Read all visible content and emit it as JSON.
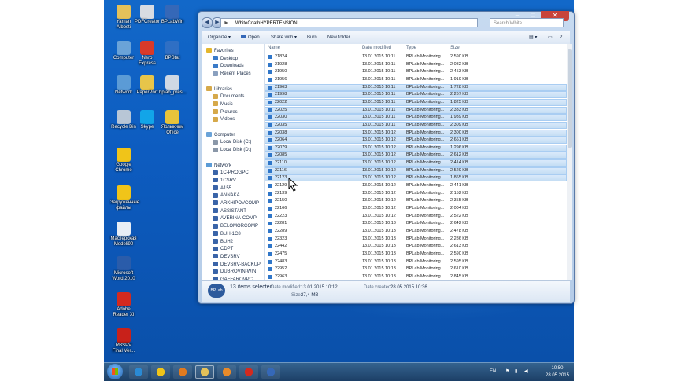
{
  "desktop_icons": [
    {
      "label": "Yaman Albosti",
      "icon": "folder-icon",
      "color": "#e4c15a"
    },
    {
      "label": "PDFCreator",
      "icon": "pdfcreator-icon",
      "color": "#d8dce2"
    },
    {
      "label": "BPLabWin",
      "icon": "bplab-icon",
      "color": "#3568b8"
    },
    {
      "label": "Computer",
      "icon": "computer-icon",
      "color": "#6aa3d8"
    },
    {
      "label": "Nero Express",
      "icon": "nero-icon",
      "color": "#d83a2a"
    },
    {
      "label": "BPStat",
      "icon": "bpstat-icon",
      "color": "#2f6fc4"
    },
    {
      "label": "Network",
      "icon": "network-icon",
      "color": "#5b9bd6"
    },
    {
      "label": "PaperPort",
      "icon": "paperport-icon",
      "color": "#e7c54a"
    },
    {
      "label": "bplab_pres...",
      "icon": "presentation-icon",
      "color": "#cfd8e4"
    },
    {
      "label": "Recycle Bin",
      "icon": "recycle-bin-icon",
      "color": "#b8c6d6"
    },
    {
      "label": "Skype",
      "icon": "skype-icon",
      "color": "#12a5e8"
    },
    {
      "label": "Ярлыкивм Office",
      "icon": "office-icon",
      "color": "#e7c33b"
    },
    {
      "label": "Google Chrome",
      "icon": "chrome-icon",
      "color": "#f0c419"
    },
    {
      "label": "Загруженные файлы",
      "icon": "chrome-icon",
      "color": "#f0c419"
    },
    {
      "label": "Мастерская Medeli90",
      "icon": "document-icon",
      "color": "#e8eef5"
    },
    {
      "label": "Microsoft Word 2010",
      "icon": "word-icon",
      "color": "#2a5caa"
    },
    {
      "label": "Adobe Reader XI",
      "icon": "adobe-reader-icon",
      "color": "#d32a1f"
    },
    {
      "label": "RBSPV Final Ver...",
      "icon": "app-icon",
      "color": "#c8211a"
    }
  ],
  "window": {
    "address": "WhiteCoathHYPERTENSION",
    "search_placeholder": "Search White...",
    "controls": {
      "minimize": "–",
      "maximize": "□",
      "close": "✕"
    },
    "nav_back": "◀",
    "nav_forward": "▶",
    "toolbar": {
      "organize": "Organize ▾",
      "open": "Open",
      "share": "Share with ▾",
      "burn": "Burn",
      "new_folder": "New folder"
    },
    "nav_items": [
      {
        "label": "Favorites",
        "icon": "star-icon",
        "color": "#e4b62c",
        "level": 0
      },
      {
        "label": "Desktop",
        "icon": "desktop-icon",
        "color": "#3a7bc8",
        "level": 1
      },
      {
        "label": "Downloads",
        "icon": "downloads-icon",
        "color": "#3a7bc8",
        "level": 1
      },
      {
        "label": "Recent Places",
        "icon": "recent-places-icon",
        "color": "#8aa0bf",
        "level": 1
      },
      {
        "label": "",
        "icon": "",
        "color": "",
        "level": -1
      },
      {
        "label": "Libraries",
        "icon": "libraries-icon",
        "color": "#d6a94a",
        "level": 0
      },
      {
        "label": "Documents",
        "icon": "documents-icon",
        "color": "#d6a94a",
        "level": 1
      },
      {
        "label": "Music",
        "icon": "music-icon",
        "color": "#d6a94a",
        "level": 1
      },
      {
        "label": "Pictures",
        "icon": "pictures-icon",
        "color": "#d6a94a",
        "level": 1
      },
      {
        "label": "Videos",
        "icon": "videos-icon",
        "color": "#d6a94a",
        "level": 1
      },
      {
        "label": "",
        "icon": "",
        "color": "",
        "level": -1
      },
      {
        "label": "Computer",
        "icon": "computer-icon",
        "color": "#6aa3d8",
        "level": 0
      },
      {
        "label": "Local Disk (C:)",
        "icon": "disk-icon",
        "color": "#8a97a8",
        "level": 1
      },
      {
        "label": "Local Disk (D:)",
        "icon": "disk-icon",
        "color": "#8a97a8",
        "level": 1
      },
      {
        "label": "",
        "icon": "",
        "color": "",
        "level": -1
      },
      {
        "label": "Network",
        "icon": "network-icon",
        "color": "#5b9bd6",
        "level": 0
      },
      {
        "label": "1C-PROGPC",
        "icon": "pc-icon",
        "color": "#3a64a8",
        "level": 1
      },
      {
        "label": "1CSRV",
        "icon": "pc-icon",
        "color": "#3a64a8",
        "level": 1
      },
      {
        "label": "A155",
        "icon": "pc-icon",
        "color": "#3a64a8",
        "level": 1
      },
      {
        "label": "ANNAKA",
        "icon": "pc-icon",
        "color": "#3a64a8",
        "level": 1
      },
      {
        "label": "ARKHIPOVCOMP",
        "icon": "pc-icon",
        "color": "#3a64a8",
        "level": 1
      },
      {
        "label": "ASSISTANT",
        "icon": "pc-icon",
        "color": "#3a64a8",
        "level": 1
      },
      {
        "label": "AVERINA-COMP",
        "icon": "pc-icon",
        "color": "#3a64a8",
        "level": 1
      },
      {
        "label": "BELOMORCOMP",
        "icon": "pc-icon",
        "color": "#3a64a8",
        "level": 1
      },
      {
        "label": "BUH-1C8",
        "icon": "pc-icon",
        "color": "#3a64a8",
        "level": 1
      },
      {
        "label": "BUH2",
        "icon": "pc-icon",
        "color": "#3a64a8",
        "level": 1
      },
      {
        "label": "CDPT",
        "icon": "pc-icon",
        "color": "#3a64a8",
        "level": 1
      },
      {
        "label": "DEVSRV",
        "icon": "pc-icon",
        "color": "#3a64a8",
        "level": 1
      },
      {
        "label": "DEVSRV-BACKUP",
        "icon": "pc-icon",
        "color": "#3a64a8",
        "level": 1
      },
      {
        "label": "DUBROVIN-WIN",
        "icon": "pc-icon",
        "color": "#3a64a8",
        "level": 1
      },
      {
        "label": "GAFFAROVPC",
        "icon": "pc-icon",
        "color": "#3a64a8",
        "level": 1
      }
    ],
    "columns": {
      "name": "Name",
      "date": "Date modified",
      "type": "Type",
      "size": "Size"
    },
    "files": [
      {
        "name": "21824",
        "date": "13.01.2015 10:11",
        "type": "BPLab Monitoring...",
        "size": "2 590 KB",
        "selected": false
      },
      {
        "name": "21928",
        "date": "13.01.2015 10:11",
        "type": "BPLab Monitoring...",
        "size": "2 082 KB",
        "selected": false
      },
      {
        "name": "21950",
        "date": "13.01.2015 10:11",
        "type": "BPLab Monitoring...",
        "size": "2 453 KB",
        "selected": false
      },
      {
        "name": "21956",
        "date": "13.01.2015 10:11",
        "type": "BPLab Monitoring...",
        "size": "1 919 KB",
        "selected": false
      },
      {
        "name": "21963",
        "date": "13.01.2015 10:11",
        "type": "BPLab Monitoring...",
        "size": "1 728 KB",
        "selected": true
      },
      {
        "name": "21998",
        "date": "13.01.2015 10:11",
        "type": "BPLab Monitoring...",
        "size": "2 267 KB",
        "selected": true
      },
      {
        "name": "22022",
        "date": "13.01.2015 10:11",
        "type": "BPLab Monitoring...",
        "size": "1 825 KB",
        "selected": true
      },
      {
        "name": "22025",
        "date": "13.01.2015 10:11",
        "type": "BPLab Monitoring...",
        "size": "2 333 KB",
        "selected": true
      },
      {
        "name": "22030",
        "date": "13.01.2015 10:11",
        "type": "BPLab Monitoring...",
        "size": "1 939 KB",
        "selected": true
      },
      {
        "name": "22035",
        "date": "13.01.2015 10:11",
        "type": "BPLab Monitoring...",
        "size": "2 309 KB",
        "selected": true
      },
      {
        "name": "22038",
        "date": "13.01.2015 10:12",
        "type": "BPLab Monitoring...",
        "size": "2 300 KB",
        "selected": true
      },
      {
        "name": "22064",
        "date": "13.01.2015 10:12",
        "type": "BPLab Monitoring...",
        "size": "2 661 KB",
        "selected": true
      },
      {
        "name": "22079",
        "date": "13.01.2015 10:12",
        "type": "BPLab Monitoring...",
        "size": "1 296 KB",
        "selected": true
      },
      {
        "name": "22085",
        "date": "13.01.2015 10:12",
        "type": "BPLab Monitoring...",
        "size": "2 612 KB",
        "selected": true
      },
      {
        "name": "22110",
        "date": "13.01.2015 10:12",
        "type": "BPLab Monitoring...",
        "size": "2 414 KB",
        "selected": true
      },
      {
        "name": "22116",
        "date": "13.01.2015 10:12",
        "type": "BPLab Monitoring...",
        "size": "2 529 KB",
        "selected": true
      },
      {
        "name": "22123",
        "date": "13.01.2015 10:12",
        "type": "BPLab Monitoring...",
        "size": "1 865 KB",
        "selected": true
      },
      {
        "name": "22129",
        "date": "13.01.2015 10:12",
        "type": "BPLab Monitoring...",
        "size": "2 441 KB",
        "selected": false
      },
      {
        "name": "22139",
        "date": "13.01.2015 10:12",
        "type": "BPLab Monitoring...",
        "size": "2 152 KB",
        "selected": false
      },
      {
        "name": "22150",
        "date": "13.01.2015 10:12",
        "type": "BPLab Monitoring...",
        "size": "2 355 KB",
        "selected": false
      },
      {
        "name": "22166",
        "date": "13.01.2015 10:12",
        "type": "BPLab Monitoring...",
        "size": "2 004 KB",
        "selected": false
      },
      {
        "name": "22223",
        "date": "13.01.2015 10:12",
        "type": "BPLab Monitoring...",
        "size": "2 522 KB",
        "selected": false
      },
      {
        "name": "22281",
        "date": "13.01.2015 10:13",
        "type": "BPLab Monitoring...",
        "size": "2 642 KB",
        "selected": false
      },
      {
        "name": "22289",
        "date": "13.01.2015 10:13",
        "type": "BPLab Monitoring...",
        "size": "2 478 KB",
        "selected": false
      },
      {
        "name": "22323",
        "date": "13.01.2015 10:13",
        "type": "BPLab Monitoring...",
        "size": "2 286 KB",
        "selected": false
      },
      {
        "name": "22442",
        "date": "13.01.2015 10:13",
        "type": "BPLab Monitoring...",
        "size": "2 613 KB",
        "selected": false
      },
      {
        "name": "22475",
        "date": "13.01.2015 10:13",
        "type": "BPLab Monitoring...",
        "size": "2 590 KB",
        "selected": false
      },
      {
        "name": "22483",
        "date": "13.01.2015 10:13",
        "type": "BPLab Monitoring...",
        "size": "2 595 KB",
        "selected": false
      },
      {
        "name": "22952",
        "date": "13.01.2015 10:13",
        "type": "BPLab Monitoring...",
        "size": "2 610 KB",
        "selected": false
      },
      {
        "name": "22963",
        "date": "13.01.2015 10:13",
        "type": "BPLab Monitoring...",
        "size": "2 845 KB",
        "selected": false
      }
    ],
    "details": {
      "badge": "BPLab",
      "selected_count": "13 items selected",
      "date_modified_label": "Date modified:",
      "date_modified": "13.01.2015 10:12",
      "date_created_label": "Date created:",
      "date_created": "28.05.2015 10:36",
      "size_label": "Size:",
      "size": "27,4 MB"
    }
  },
  "taskbar": {
    "start_icon": "windows-start-icon",
    "pinned": [
      {
        "icon": "internet-explorer-icon",
        "color": "#2a8ad4"
      },
      {
        "icon": "chrome-icon",
        "color": "#f0c419"
      },
      {
        "icon": "outlook-icon",
        "color": "#e07a1f"
      },
      {
        "icon": "explorer-icon",
        "color": "#e4c15a"
      },
      {
        "icon": "media-player-icon",
        "color": "#e88a2a"
      },
      {
        "icon": "adobe-reader-icon",
        "color": "#d32a1f"
      },
      {
        "icon": "bplab-icon",
        "color": "#3568b8"
      }
    ],
    "language": "EN",
    "time": "10:50",
    "date": "28.05.2015"
  }
}
